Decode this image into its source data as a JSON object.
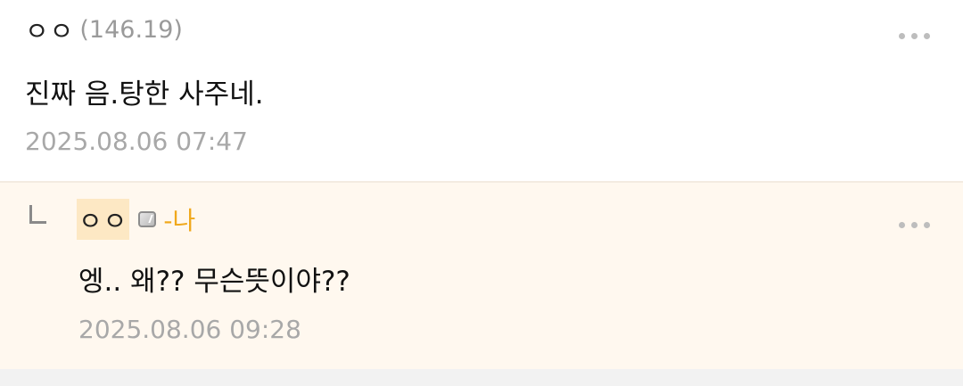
{
  "comment": {
    "nickname": "ㅇㅇ",
    "ip": "(146.19)",
    "text": "진짜 음.탕한 사주네.",
    "date": "2025.08.06 07:47",
    "more_icon": "more-dots-icon"
  },
  "reply": {
    "arrow_icon": "reply-arrow-icon",
    "nickname": "ㅇㅇ",
    "fixed_icon": "fixed-nick-icon",
    "op_badge": "-나",
    "text": "엥.. 왜?? 무슨뜻이야??",
    "date": "2025.08.06 09:28",
    "more_icon": "more-dots-icon"
  },
  "colors": {
    "reply_background": "#fff8ef",
    "op_badge": "#f0a81b",
    "date": "#a8a8a8"
  }
}
